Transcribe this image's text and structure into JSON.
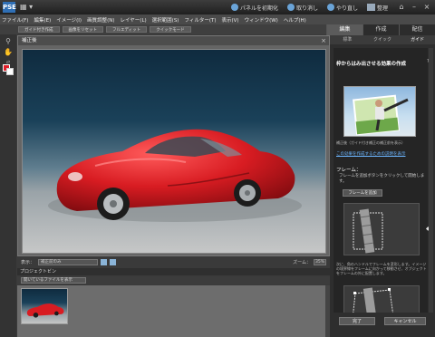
{
  "titlebar": {
    "logo_text": "PSE",
    "menu_glyph": "▦ ▾",
    "actions": [
      {
        "icon": "reset-panels-icon",
        "label": "パネルを初期化"
      },
      {
        "icon": "undo-icon",
        "label": "取り消し"
      },
      {
        "icon": "redo-icon",
        "label": "やり直し"
      },
      {
        "icon": "organizer-icon",
        "label": "整理"
      }
    ],
    "home_glyph": "⌂",
    "minimize": "–",
    "close": "×"
  },
  "menubar": [
    "ファイル(F)",
    "編集(E)",
    "イメージ(I)",
    "画質調整(N)",
    "レイヤー(L)",
    "選択範囲(S)",
    "フィルター(T)",
    "表示(V)",
    "ウィンドウ(W)",
    "ヘルプ(H)"
  ],
  "options_bar": [
    "ガイド付き作成",
    "画像をリセット",
    "フルエディット",
    "クイックモード"
  ],
  "main_tabs": [
    "編集",
    "作成",
    "配信"
  ],
  "sub_tabs": [
    "標準",
    "クイック",
    "ガイド"
  ],
  "document": {
    "title": "補正後",
    "close": "×"
  },
  "doc_status": {
    "view_label": "表示：",
    "view_value": "補正前のみ",
    "zoom_label": "ズーム：",
    "zoom_value": "35%"
  },
  "project_bin": {
    "title": "プロジェクトビン",
    "dropdown": "開いているファイルを表示"
  },
  "guide_panel": {
    "heading": "枠からはみ出させる効果の作成",
    "star": "?",
    "caption": "補正後（ガイド付き補正の補正前を表示）",
    "link": "この効果を作成するための説明を表示",
    "frame_label": "フレーム：",
    "frame_desc": "フレームを追加ボタンをクリックして開始します。",
    "frame_button": "フレームを追加",
    "desc2": "次に、角のハンドルでフレームを変形します。イメージの境界線をフレームに向かって移動させ、オブジェクトをフレームの外に配置します。",
    "ok": "完了",
    "cancel": "キャンセル"
  },
  "colors": {
    "foreground": "#e01e2a",
    "background": "#ffffff",
    "link": "#6cb6ff"
  }
}
